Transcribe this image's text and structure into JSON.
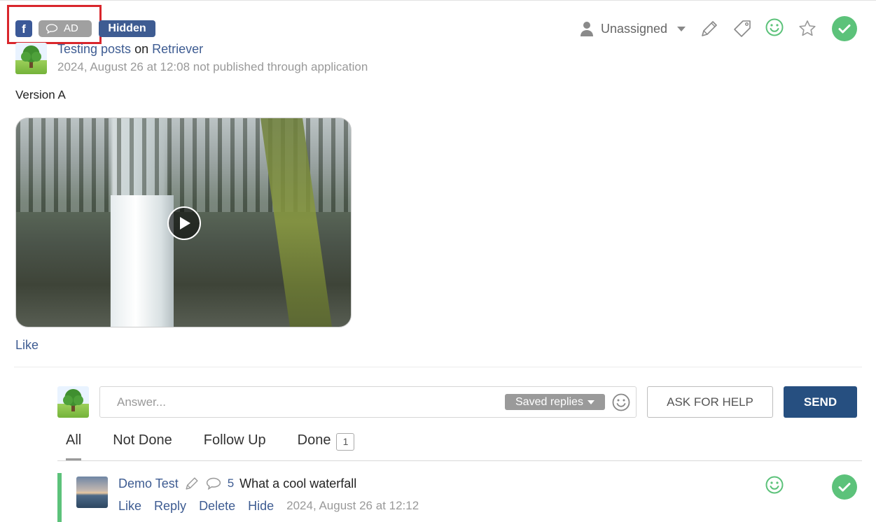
{
  "header": {
    "network_badge": "f",
    "type_badge": "AD",
    "status_badge": "Hidden",
    "assignee": "Unassigned"
  },
  "post": {
    "author": "Testing posts",
    "on_word": "on",
    "page": "Retriever",
    "meta": "2024, August 26 at 12:08 not published through application",
    "text": "Version A",
    "like_label": "Like"
  },
  "reply": {
    "placeholder": "Answer...",
    "saved_replies": "Saved replies",
    "ask_for_help": "ASK FOR HELP",
    "send": "SEND"
  },
  "tabs": [
    {
      "label": "All"
    },
    {
      "label": "Not Done"
    },
    {
      "label": "Follow Up"
    },
    {
      "label": "Done",
      "count": "1"
    }
  ],
  "comment": {
    "author": "Demo Test",
    "reply_count": "5",
    "text": "What a cool waterfall",
    "actions": [
      "Like",
      "Reply",
      "Delete",
      "Hide"
    ],
    "time": "2024, August 26 at 12:12"
  },
  "colors": {
    "facebook": "#3b5998",
    "accent_blue": "#3e5c92",
    "send_blue": "#264f80",
    "done_green": "#5cc27a",
    "highlight_red": "#d9262c"
  },
  "icons": [
    "facebook-icon",
    "comment-bubble-icon",
    "user-icon",
    "pencil-icon",
    "tag-icon",
    "smiley-icon",
    "star-icon",
    "check-icon",
    "play-icon"
  ]
}
